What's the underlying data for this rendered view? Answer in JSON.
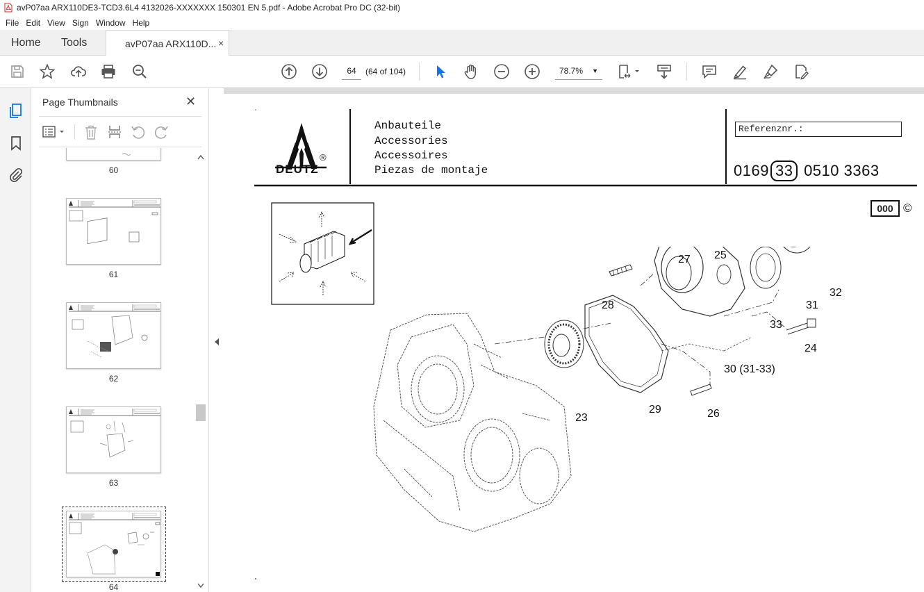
{
  "window": {
    "title": "avP07aa ARX110DE3-TCD3.6L4 4132026-XXXXXXX 150301 EN 5.pdf - Adobe Acrobat Pro DC (32-bit)"
  },
  "menu": [
    "File",
    "Edit",
    "View",
    "Sign",
    "Window",
    "Help"
  ],
  "tabs": {
    "home": "Home",
    "tools": "Tools",
    "document": "avP07aa ARX110D...",
    "close_glyph": "×"
  },
  "toolbar": {
    "page_number": "64",
    "page_count": "(64 of 104)",
    "zoom": "78.7%",
    "zoom_arrow": "▼"
  },
  "thumbnails_panel": {
    "title": "Page Thumbnails",
    "close_glyph": "✕",
    "pages": [
      {
        "label": "60"
      },
      {
        "label": "61"
      },
      {
        "label": "62"
      },
      {
        "label": "63"
      },
      {
        "label": "64",
        "selected": true
      }
    ]
  },
  "document": {
    "brand": "DEUTZ",
    "registered": "®",
    "headings": [
      "Anbauteile",
      "Accessories",
      "Accessoires",
      "Piezas de montaje"
    ],
    "reference_label": "Referenznr.:",
    "part_number_prefix": "0169",
    "part_number_group": "33",
    "part_number_suffix": "0510  3363",
    "code_box": "000",
    "copyright": "©",
    "callouts": [
      "27",
      "25",
      "28",
      "31",
      "32",
      "33",
      "24",
      "30 (31-33)",
      "23",
      "29",
      "26"
    ]
  },
  "colors": {
    "accent_blue": "#1473e6",
    "pdf_red": "#d42a2a"
  }
}
